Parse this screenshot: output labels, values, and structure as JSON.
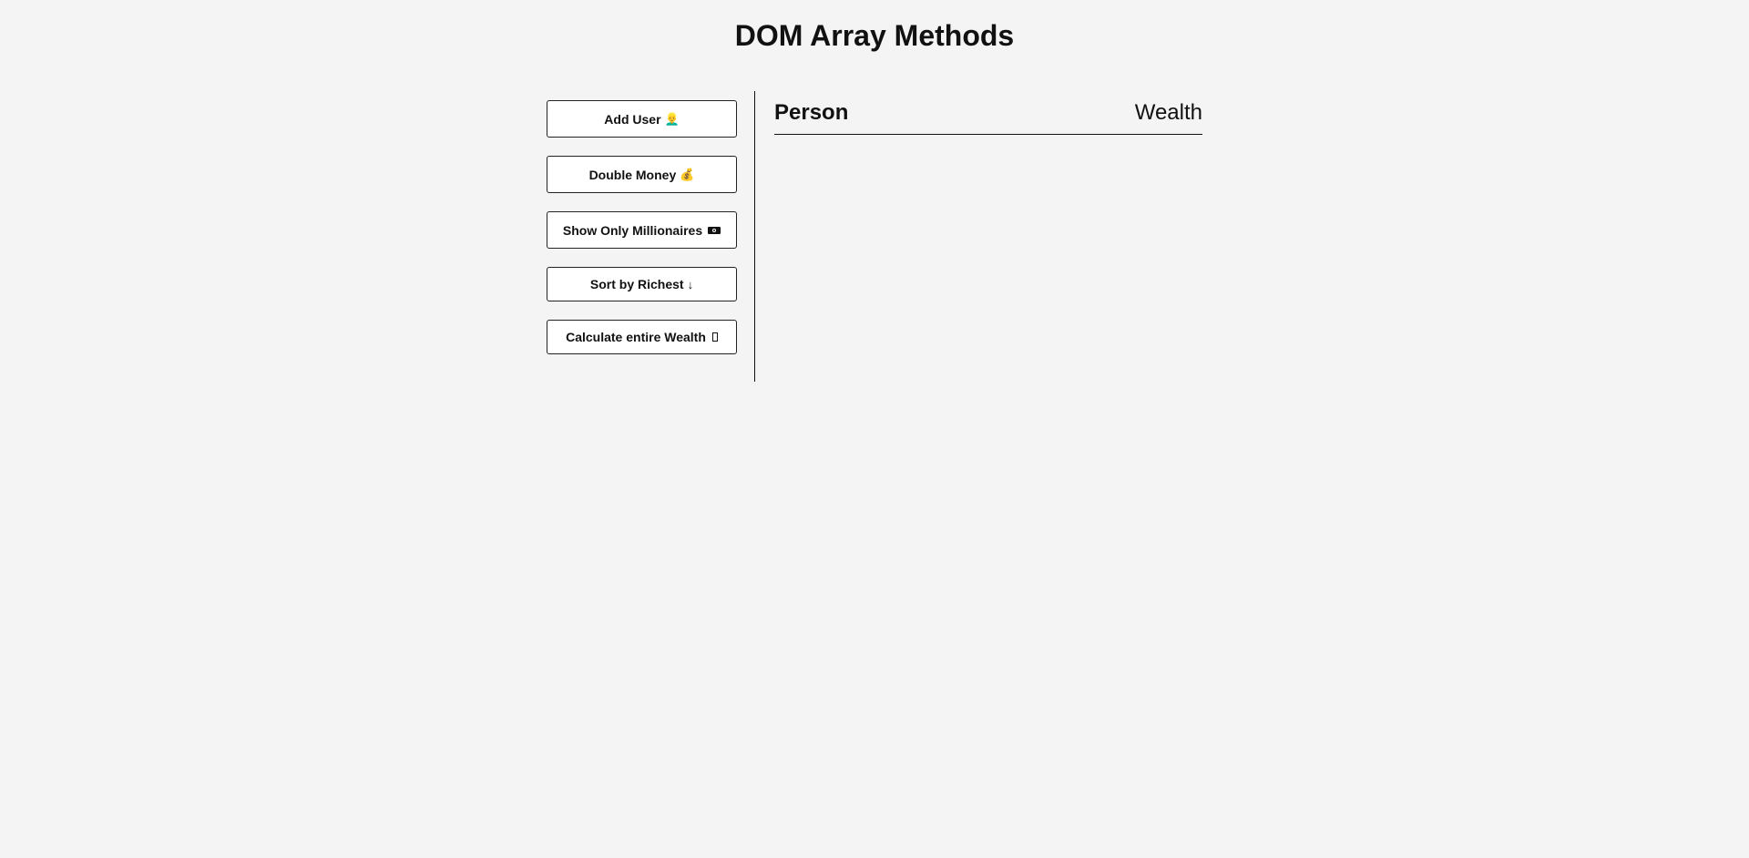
{
  "page": {
    "title": "DOM Array Methods"
  },
  "controls": {
    "add_user": {
      "label": "Add User",
      "icon": "👱‍♂️"
    },
    "double_money": {
      "label": "Double Money",
      "icon": "💰"
    },
    "show_millionaires": {
      "label": "Show Only Millionaires"
    },
    "sort_richest": {
      "label": "Sort by Richest",
      "icon": "↓"
    },
    "calculate_wealth": {
      "label": "Calculate entire Wealth"
    }
  },
  "table": {
    "columns": [
      "Person",
      "Wealth"
    ]
  }
}
